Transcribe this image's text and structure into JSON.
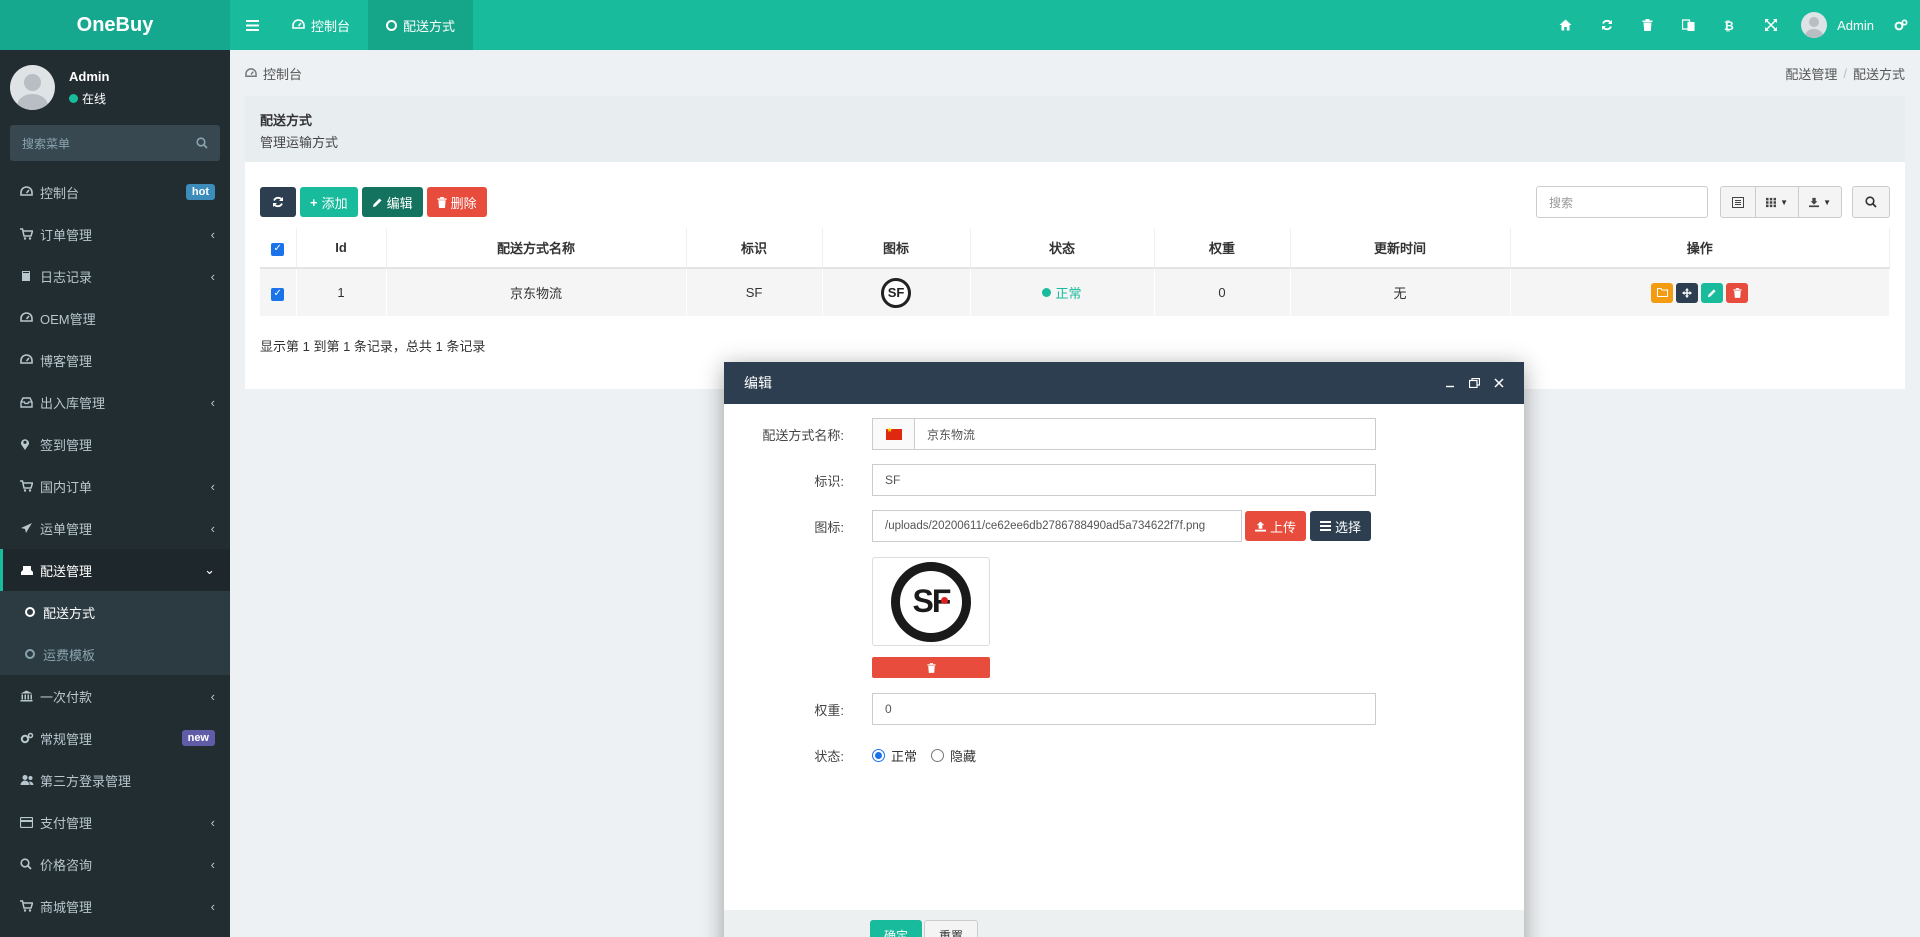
{
  "brand": "OneBuy",
  "topbar": {
    "tabs": [
      {
        "label": "控制台",
        "icon": "dashboard-icon"
      },
      {
        "label": "配送方式",
        "icon": "circle-icon"
      }
    ],
    "user_name": "Admin"
  },
  "sidebar": {
    "user_name": "Admin",
    "user_status": "在线",
    "search_placeholder": "搜索菜单",
    "items": [
      {
        "label": "控制台",
        "icon": "dashboard-icon",
        "badge": "hot"
      },
      {
        "label": "订单管理",
        "icon": "cart-icon",
        "chevron": "‹"
      },
      {
        "label": "日志记录",
        "icon": "book-icon",
        "chevron": "‹"
      },
      {
        "label": "OEM管理",
        "icon": "dashboard-icon"
      },
      {
        "label": "博客管理",
        "icon": "dashboard-icon"
      },
      {
        "label": "出入库管理",
        "icon": "inbox-icon",
        "chevron": "‹"
      },
      {
        "label": "签到管理",
        "icon": "map-marker-icon"
      },
      {
        "label": "国内订单",
        "icon": "cart-icon",
        "chevron": "‹"
      },
      {
        "label": "运单管理",
        "icon": "plane-icon",
        "chevron": "‹"
      },
      {
        "label": "配送管理",
        "icon": "truck-icon",
        "chevron": "⌄"
      }
    ],
    "sub_items": [
      {
        "label": "配送方式",
        "active": true
      },
      {
        "label": "运费模板",
        "active": false
      }
    ],
    "items_after": [
      {
        "label": "一次付款",
        "icon": "bank-icon",
        "chevron": "‹"
      },
      {
        "label": "常规管理",
        "icon": "gears-icon",
        "badge": "new"
      },
      {
        "label": "第三方登录管理",
        "icon": "users-icon"
      },
      {
        "label": "支付管理",
        "icon": "credit-card-icon",
        "chevron": "‹"
      },
      {
        "label": "价格咨询",
        "icon": "search-icon",
        "chevron": "‹"
      },
      {
        "label": "商城管理",
        "icon": "cart-icon",
        "chevron": "‹"
      }
    ]
  },
  "breadcrumb": {
    "home": "控制台",
    "right": [
      "配送管理",
      "配送方式"
    ]
  },
  "panel": {
    "title": "配送方式",
    "subtitle": "管理运输方式"
  },
  "toolbar": {
    "add": "添加",
    "edit": "编辑",
    "delete": "删除",
    "search_placeholder": "搜索"
  },
  "table": {
    "headers": [
      "Id",
      "配送方式名称",
      "标识",
      "图标",
      "状态",
      "权重",
      "更新时间",
      "操作"
    ],
    "rows": [
      {
        "id": "1",
        "name": "京东物流",
        "code": "SF",
        "icon_text": "SF",
        "status": "正常",
        "weight": "0",
        "updated": "无"
      }
    ],
    "page_info": "显示第 1 到第 1 条记录，总共 1 条记录"
  },
  "modal": {
    "title": "编辑",
    "labels": {
      "name": "配送方式名称:",
      "code": "标识:",
      "icon": "图标:",
      "weight": "权重:",
      "status": "状态:"
    },
    "values": {
      "name": "京东物流",
      "code": "SF",
      "icon_path": "/uploads/20200611/ce62ee6db2786788490ad5a734622f7f.png",
      "weight": "0"
    },
    "upload_btn": "上传",
    "choose_btn": "选择",
    "preview_text": "SF",
    "status_options": [
      "正常",
      "隐藏"
    ],
    "status_selected": "正常",
    "confirm_btn": "确定",
    "reset_btn": "重置"
  },
  "colors": {
    "primary": "#18bc9c",
    "dark": "#2c3e50",
    "danger": "#e74c3c",
    "warning": "#f39c12",
    "sidebar_bg": "#222d32"
  }
}
